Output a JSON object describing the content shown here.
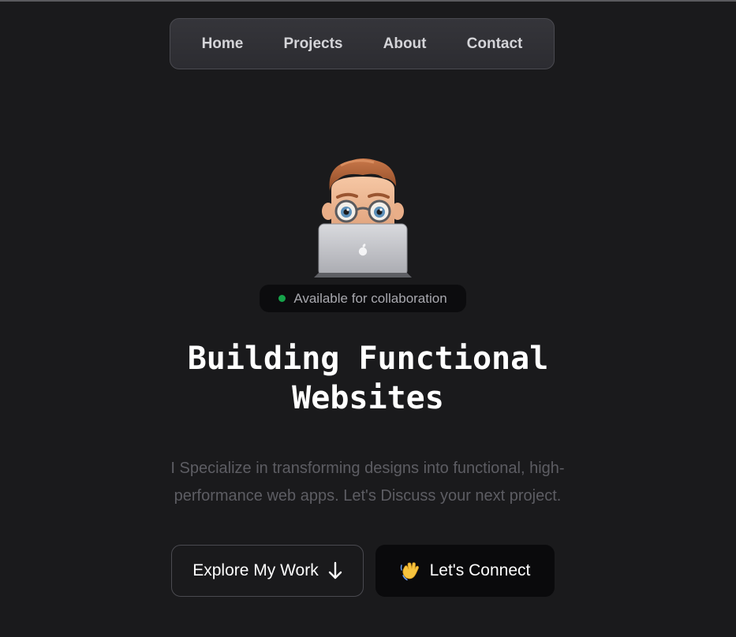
{
  "nav": {
    "items": [
      {
        "label": "Home"
      },
      {
        "label": "Projects"
      },
      {
        "label": "About"
      },
      {
        "label": "Contact"
      }
    ]
  },
  "hero": {
    "avatar_icon": "memoji-laptop-avatar",
    "status": {
      "text": "Available for collaboration",
      "dot_color": "#16a34a"
    },
    "headline_line1": "Building Functional",
    "headline_line2": "Websites",
    "subtitle": "I Specialize in transforming designs into functional, high-performance web apps. Let's Discuss your next project.",
    "buttons": {
      "explore_label": "Explore My Work",
      "explore_icon": "arrow-down-icon",
      "connect_label": "Let's Connect",
      "connect_icon": "waving-hand-icon"
    }
  },
  "colors": {
    "background": "#1a1a1c",
    "nav_background": "#2f2f34",
    "status_dot": "#16a34a",
    "subtitle": "#5d5d63"
  }
}
